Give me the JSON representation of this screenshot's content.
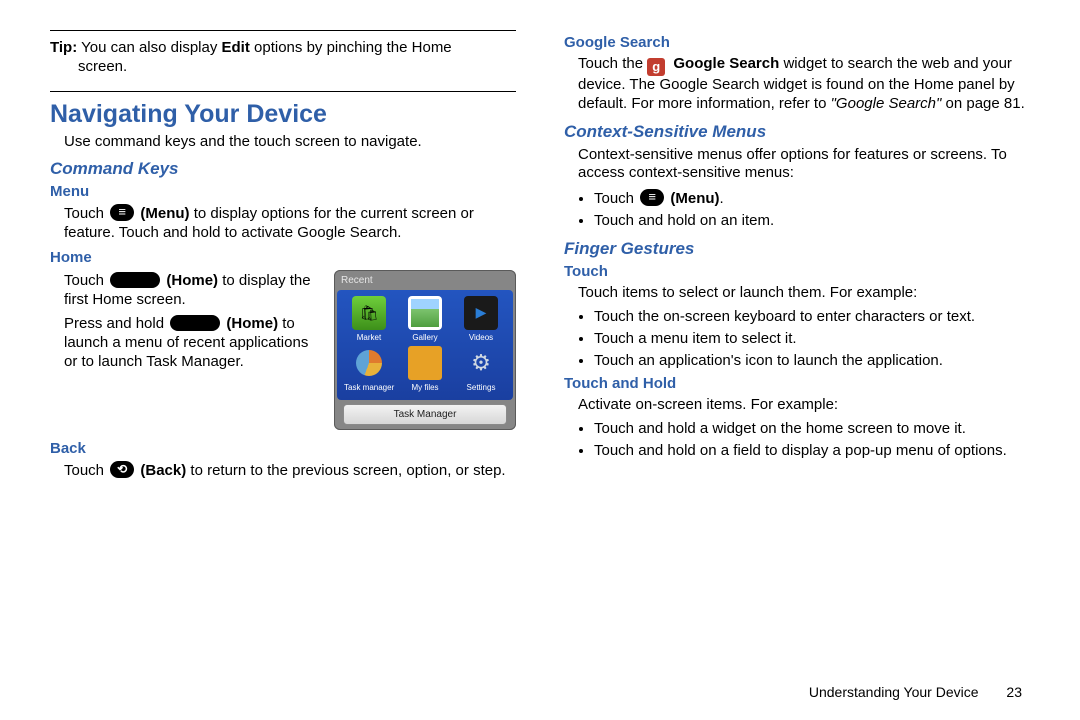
{
  "tip": {
    "label": "Tip:",
    "line1": "You can also display",
    "edit": "Edit",
    "line1b": "options by pinching the Home",
    "line2": "screen."
  },
  "h1": "Navigating Your Device",
  "intro": "Use command keys and the touch screen to navigate.",
  "cmdkeys": {
    "title": "Command Keys",
    "menu": {
      "title": "Menu",
      "p1a": "Touch",
      "p1b": "(Menu)",
      "p1c": "to display options for the current screen or feature. Touch and hold to activate Google Search."
    },
    "home": {
      "title": "Home",
      "p1a": "Touch",
      "p1b": "(Home)",
      "p1c": "to display the first Home screen.",
      "p2a": "Press and hold",
      "p2b": "(Home)",
      "p2c": "to launch a menu of recent applications or to launch Task Manager."
    },
    "back": {
      "title": "Back",
      "p1a": "Touch",
      "p1b": "(Back)",
      "p1c": "to return to the previous screen, option, or step."
    }
  },
  "panel": {
    "title": "Recent",
    "apps": [
      "Market",
      "Gallery",
      "Videos",
      "Task manager",
      "My files",
      "Settings"
    ],
    "button": "Task Manager"
  },
  "gsearch": {
    "title": "Google Search",
    "p_a": "Touch the",
    "p_b": "Google Search",
    "p_c": "widget to search the web and your device. The Google Search widget is found on the Home panel by default. For more information, refer to",
    "ref": "\"Google Search\"",
    "p_d": "on page 81."
  },
  "context": {
    "title": "Context-Sensitive Menus",
    "intro": "Context-sensitive menus offer options for features or screens. To access context-sensitive menus:",
    "items": {
      "b1a": "Touch",
      "b1b": "(Menu)",
      "b1c": ".",
      "b2": "Touch and hold on an item."
    }
  },
  "gestures": {
    "title": "Finger Gestures",
    "touch": {
      "title": "Touch",
      "intro": "Touch items to select or launch them. For example:",
      "b1": "Touch the on-screen keyboard to enter characters or text.",
      "b2": "Touch a menu item to select it.",
      "b3": "Touch an application's icon to launch the application."
    },
    "hold": {
      "title": "Touch and Hold",
      "intro": "Activate on-screen items. For example:",
      "b1": "Touch and hold a widget on the home screen to move it.",
      "b2": "Touch and hold on a field to display a pop-up menu of options."
    }
  },
  "footer": {
    "text": "Understanding Your Device",
    "page": "23"
  }
}
